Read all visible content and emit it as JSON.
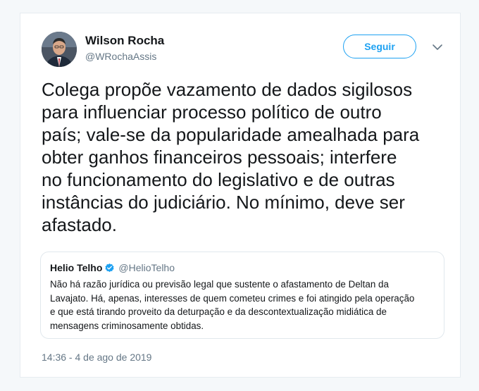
{
  "tweet": {
    "author": {
      "name": "Wilson Rocha",
      "handle": "@WRochaAssis"
    },
    "follow_label": "Seguir",
    "text_lines": [
      "Colega propõe vazamento de dados sigilosos",
      "para influenciar processo político de outro",
      "país; vale-se da popularidade amealhada para",
      "obter ganhos financeiros pessoais; interfere",
      "no funcionamento do legislativo e de outras",
      "instâncias do judiciário. No mínimo, deve ser",
      "afastado."
    ],
    "timestamp": "14:36 - 4 de ago de 2019"
  },
  "quote": {
    "name": "Helio Telho",
    "handle": "@HelioTelho",
    "verified": true,
    "text_lines": [
      "Não há razão jurídica ou previsão legal que sustente o afastamento de Deltan da",
      "Lavajato. Há, apenas, interesses de quem cometeu crimes e foi atingido pela operação",
      "e que está tirando proveito da deturpação e da descontextualização  midiática de",
      "mensagens criminosamente obtidas."
    ]
  },
  "icons": {
    "avatar": "profile-photo",
    "caret": "chevron-down-icon",
    "verified": "verified-badge-icon"
  },
  "colors": {
    "accent": "#1da1f2",
    "text": "#14171a",
    "secondary": "#657786",
    "border": "#e1e8ed",
    "background": "#f5f8fa"
  }
}
